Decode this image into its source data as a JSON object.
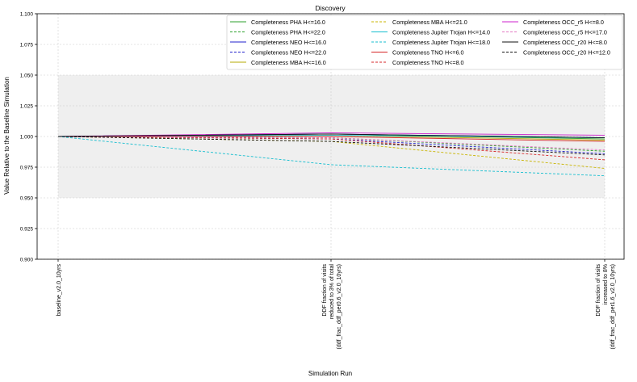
{
  "chart_data": {
    "type": "line",
    "title": "Discovery",
    "xlabel": "Simulation Run",
    "ylabel": "Value Relative to the Baseline Simulation",
    "ylim": [
      0.9,
      1.1
    ],
    "yticks": [
      "0.900",
      "0.925",
      "0.950",
      "0.975",
      "1.000",
      "1.025",
      "1.050",
      "1.075",
      "1.100"
    ],
    "grid": true,
    "shaded_band": [
      0.95,
      1.05
    ],
    "legend_position": "top-right",
    "categories": [
      [
        "baseline_v2.0_10yrs"
      ],
      [
        "DDF fraction of visits",
        "reduced to 3% of total",
        "(ddf_frac_ddf_per0.6_v2.0_10yrs)"
      ],
      [
        "DDF fraction of visits",
        "increased to 8%",
        "(ddf_frac_ddf_per1.6_v2.0_10yrs)"
      ]
    ],
    "series": [
      {
        "name": "Completeness PHA H<=16.0",
        "color": "#2ca02c",
        "dash": "solid",
        "values": [
          1.0,
          1.002,
          0.998
        ]
      },
      {
        "name": "Completeness PHA H<=22.0",
        "color": "#2ca02c",
        "dash": "dashed",
        "values": [
          1.0,
          0.999,
          0.988
        ]
      },
      {
        "name": "Completeness NEO H<=16.0",
        "color": "#2222cc",
        "dash": "solid",
        "values": [
          1.0,
          1.002,
          0.999
        ]
      },
      {
        "name": "Completeness NEO H<=22.0",
        "color": "#2222cc",
        "dash": "dashed",
        "values": [
          1.0,
          0.998,
          0.986
        ]
      },
      {
        "name": "Completeness MBA H<=16.0",
        "color": "#b5a800",
        "dash": "solid",
        "values": [
          1.0,
          1.001,
          0.997
        ]
      },
      {
        "name": "Completeness MBA H<=21.0",
        "color": "#c8b400",
        "dash": "dashed",
        "values": [
          1.0,
          0.996,
          0.974
        ]
      },
      {
        "name": "Completeness Jupiter Trojan H<=14.0",
        "color": "#17becf",
        "dash": "solid",
        "values": [
          1.0,
          1.001,
          0.999
        ]
      },
      {
        "name": "Completeness Jupiter Trojan H<=18.0",
        "color": "#17becf",
        "dash": "dashed",
        "values": [
          1.0,
          0.977,
          0.968
        ]
      },
      {
        "name": "Completeness TNO H<=6.0",
        "color": "#d62728",
        "dash": "solid",
        "values": [
          1.0,
          1.0,
          0.996
        ]
      },
      {
        "name": "Completeness TNO H<=8.0",
        "color": "#d62728",
        "dash": "dashed",
        "values": [
          1.0,
          0.998,
          0.981
        ]
      },
      {
        "name": "Completeness OCC_r5 H<=8.0",
        "color": "#cc22cc",
        "dash": "solid",
        "values": [
          1.0,
          1.003,
          1.001
        ]
      },
      {
        "name": "Completeness OCC_r5 H<=17.0",
        "color": "#e377c2",
        "dash": "dashed",
        "values": [
          1.0,
          0.999,
          0.989
        ]
      },
      {
        "name": "Completeness OCC_r20 H<=8.0",
        "color": "#111111",
        "dash": "solid",
        "values": [
          1.0,
          1.002,
          0.999
        ]
      },
      {
        "name": "Completeness OCC_r20 H<=12.0",
        "color": "#111111",
        "dash": "dashed",
        "values": [
          1.0,
          0.996,
          0.985
        ]
      }
    ]
  }
}
